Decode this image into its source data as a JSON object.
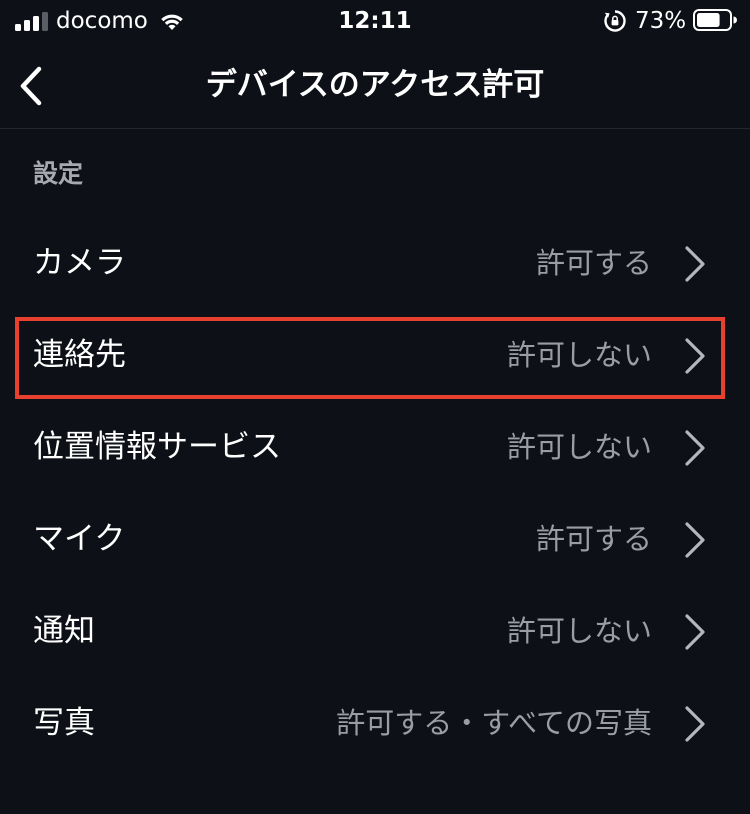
{
  "status_bar": {
    "carrier": "docomo",
    "time": "12:11",
    "battery_percent": "73%",
    "battery_level": 0.73,
    "signal_bars_total": 4,
    "signal_bars_active": 3,
    "icons": [
      "signal-icon",
      "wifi-icon",
      "rotation-lock-icon",
      "battery-icon"
    ]
  },
  "nav": {
    "title": "デバイスのアクセス許可",
    "back_icon": "chevron-left-icon"
  },
  "section": {
    "header": "設定"
  },
  "rows": [
    {
      "label": "カメラ",
      "value": "許可する"
    },
    {
      "label": "連絡先",
      "value": "許可しない"
    },
    {
      "label": "位置情報サービス",
      "value": "許可しない"
    },
    {
      "label": "マイク",
      "value": "許可する"
    },
    {
      "label": "通知",
      "value": "許可しない"
    },
    {
      "label": "写真",
      "value": "許可する・すべての写真"
    }
  ],
  "colors": {
    "background": "#0d1016",
    "primary_text": "#ffffff",
    "secondary_text": "#9a9da3",
    "section_header": "#a6a9ae",
    "highlight": "#e8402e",
    "chevron": "#b3b6bb"
  },
  "highlighted_row_index": 1
}
